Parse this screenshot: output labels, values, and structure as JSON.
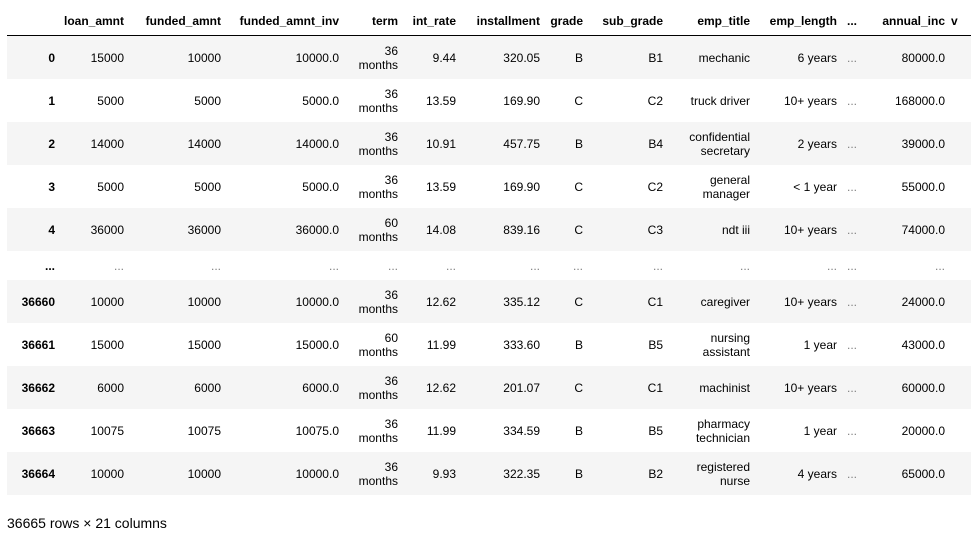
{
  "columns": [
    "loan_amnt",
    "funded_amnt",
    "funded_amnt_inv",
    "term",
    "int_rate",
    "installment",
    "grade",
    "sub_grade",
    "emp_title",
    "emp_length",
    "...",
    "annual_inc",
    "v"
  ],
  "rows": [
    {
      "index": "0",
      "cells": [
        "15000",
        "10000",
        "10000.0",
        "36 months",
        "9.44",
        "320.05",
        "B",
        "B1",
        "mechanic",
        "6 years",
        "...",
        "80000.0",
        ""
      ]
    },
    {
      "index": "1",
      "cells": [
        "5000",
        "5000",
        "5000.0",
        "36 months",
        "13.59",
        "169.90",
        "C",
        "C2",
        "truck driver",
        "10+ years",
        "...",
        "168000.0",
        ""
      ]
    },
    {
      "index": "2",
      "cells": [
        "14000",
        "14000",
        "14000.0",
        "36 months",
        "10.91",
        "457.75",
        "B",
        "B4",
        "confidential secretary",
        "2 years",
        "...",
        "39000.0",
        ""
      ]
    },
    {
      "index": "3",
      "cells": [
        "5000",
        "5000",
        "5000.0",
        "36 months",
        "13.59",
        "169.90",
        "C",
        "C2",
        "general manager",
        "< 1 year",
        "...",
        "55000.0",
        ""
      ]
    },
    {
      "index": "4",
      "cells": [
        "36000",
        "36000",
        "36000.0",
        "60 months",
        "14.08",
        "839.16",
        "C",
        "C3",
        "ndt iii",
        "10+ years",
        "...",
        "74000.0",
        ""
      ]
    },
    {
      "index": "...",
      "cells": [
        "...",
        "...",
        "...",
        "...",
        "...",
        "...",
        "...",
        "...",
        "...",
        "...",
        "...",
        "...",
        ""
      ],
      "ellipsis": true
    },
    {
      "index": "36660",
      "cells": [
        "10000",
        "10000",
        "10000.0",
        "36 months",
        "12.62",
        "335.12",
        "C",
        "C1",
        "caregiver",
        "10+ years",
        "...",
        "24000.0",
        ""
      ]
    },
    {
      "index": "36661",
      "cells": [
        "15000",
        "15000",
        "15000.0",
        "60 months",
        "11.99",
        "333.60",
        "B",
        "B5",
        "nursing assistant",
        "1 year",
        "...",
        "43000.0",
        ""
      ]
    },
    {
      "index": "36662",
      "cells": [
        "6000",
        "6000",
        "6000.0",
        "36 months",
        "12.62",
        "201.07",
        "C",
        "C1",
        "machinist",
        "10+ years",
        "...",
        "60000.0",
        ""
      ]
    },
    {
      "index": "36663",
      "cells": [
        "10075",
        "10075",
        "10075.0",
        "36 months",
        "11.99",
        "334.59",
        "B",
        "B5",
        "pharmacy technician",
        "1 year",
        "...",
        "20000.0",
        ""
      ]
    },
    {
      "index": "36664",
      "cells": [
        "10000",
        "10000",
        "10000.0",
        "36 months",
        "9.93",
        "322.35",
        "B",
        "B2",
        "registered nurse",
        "4 years",
        "...",
        "65000.0",
        ""
      ]
    }
  ],
  "shape_text": "36665 rows × 21 columns"
}
